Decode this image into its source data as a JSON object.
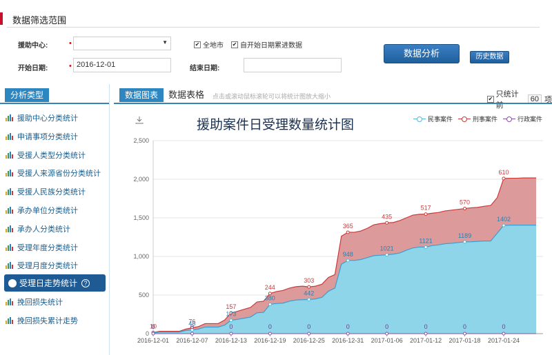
{
  "header": {
    "title": "数据筛选范围"
  },
  "filters": {
    "center_label": "援助中心:",
    "center_value": "",
    "all_city_label": "全地市",
    "cumulative_label": "自开始日期累进数据",
    "start_label": "开始日期:",
    "start_value": "2016-12-01",
    "end_label": "结束日期:",
    "end_value": "",
    "analyze_button": "数据分析",
    "history_button": "历史数据"
  },
  "sidebar": {
    "title": "分析类型",
    "items": [
      {
        "label": "援助中心分类统计"
      },
      {
        "label": "申请事项分类统计"
      },
      {
        "label": "受援人类型分类统计"
      },
      {
        "label": "受援人来源省份分类统计"
      },
      {
        "label": "受援人民族分类统计"
      },
      {
        "label": "承办单位分类统计"
      },
      {
        "label": "承办人分类统计"
      },
      {
        "label": "受理年度分类统计"
      },
      {
        "label": "受理月度分类统计"
      }
    ],
    "active_item": {
      "label": "受理日走势统计"
    },
    "after_items": [
      {
        "label": "挽回损失统计"
      },
      {
        "label": "挽回损失累计走势"
      }
    ]
  },
  "main": {
    "tab_chart": "数据图表",
    "tab_table": "数据表格",
    "hint": "点击或滚动鼠标滚轮可以将统计图放大缩小",
    "only_prefix": "只统计前",
    "only_count": "60",
    "only_suffix": "项"
  },
  "chart_data": {
    "type": "area",
    "title": "援助案件日受理数量统计图",
    "x": [
      "2016-12-01",
      "2016-12-02",
      "2016-12-03",
      "2016-12-04",
      "2016-12-05",
      "2016-12-06",
      "2016-12-07",
      "2016-12-08",
      "2016-12-09",
      "2016-12-10",
      "2016-12-11",
      "2016-12-12",
      "2016-12-13",
      "2016-12-14",
      "2016-12-15",
      "2016-12-16",
      "2016-12-17",
      "2016-12-18",
      "2016-12-19",
      "2016-12-20",
      "2016-12-21",
      "2016-12-22",
      "2016-12-23",
      "2016-12-24",
      "2016-12-25",
      "2016-12-26",
      "2016-12-27",
      "2016-12-28",
      "2016-12-29",
      "2016-12-30",
      "2016-12-31",
      "2017-01-01",
      "2017-01-02",
      "2017-01-03",
      "2017-01-04",
      "2017-01-05",
      "2017-01-06",
      "2017-01-07",
      "2017-01-08",
      "2017-01-09",
      "2017-01-10",
      "2017-01-11",
      "2017-01-12",
      "2017-01-13",
      "2017-01-14",
      "2017-01-15",
      "2017-01-16",
      "2017-01-17",
      "2017-01-18",
      "2017-01-19",
      "2017-01-20",
      "2017-01-21",
      "2017-01-22",
      "2017-01-23",
      "2017-01-24",
      "2017-01-25",
      "2017-01-26",
      "2017-01-27",
      "2017-01-28",
      "2017-01-29"
    ],
    "x_ticks": [
      "2016-12-01",
      "2016-12-07",
      "2016-12-13",
      "2016-12-19",
      "2016-12-25",
      "2016-12-31",
      "2017-01-06",
      "2017-01-12",
      "2017-01-18",
      "2017-01-24"
    ],
    "ylim": [
      0,
      2500
    ],
    "y_ticks": [
      0,
      500,
      1000,
      1500,
      2000,
      2500
    ],
    "y_tick_labels": [
      "0",
      "500",
      "1,000",
      "1,500",
      "2,000",
      "2,500"
    ],
    "series": [
      {
        "name": "民事案件",
        "color": "#55b8d8",
        "values": [
          10,
          20,
          20,
          20,
          20,
          40,
          48,
          60,
          85,
          85,
          85,
          110,
          173,
          185,
          200,
          215,
          270,
          275,
          380,
          390,
          395,
          420,
          435,
          440,
          442,
          450,
          470,
          550,
          590,
          900,
          948,
          948,
          960,
          985,
          1010,
          1015,
          1021,
          1030,
          1045,
          1080,
          1110,
          1121,
          1121,
          1140,
          1150,
          1165,
          1170,
          1180,
          1189,
          1190,
          1195,
          1200,
          1200,
          1300,
          1402,
          1405,
          1405,
          1405,
          1405,
          1405
        ]
      },
      {
        "name": "刑事案件",
        "color": "#c83a3a",
        "values": [
          5,
          10,
          10,
          10,
          10,
          18,
          28,
          32,
          45,
          45,
          45,
          65,
          95,
          105,
          115,
          125,
          140,
          145,
          140,
          155,
          165,
          170,
          173,
          175,
          163,
          165,
          170,
          178,
          175,
          362,
          365,
          365,
          370,
          380,
          400,
          410,
          414,
          410,
          420,
          420,
          425,
          425,
          427,
          420,
          420,
          425,
          430,
          430,
          431,
          440,
          440,
          450,
          460,
          460,
          608,
          608,
          608,
          612,
          612,
          612
        ]
      },
      {
        "name": "行政案件",
        "color": "#8a4fa8",
        "values": [
          0,
          0,
          0,
          0,
          0,
          0,
          0,
          0,
          0,
          0,
          0,
          0,
          0,
          0,
          0,
          0,
          0,
          0,
          0,
          0,
          0,
          0,
          0,
          0,
          0,
          0,
          0,
          0,
          0,
          0,
          0,
          0,
          0,
          0,
          0,
          0,
          0,
          0,
          0,
          0,
          0,
          0,
          0,
          0,
          0,
          0,
          0,
          0,
          0,
          0,
          0,
          0,
          0,
          0,
          0,
          0,
          0,
          0,
          0,
          0
        ]
      }
    ],
    "data_labels": [
      {
        "series": "刑事案件",
        "index": 0,
        "text": "10"
      },
      {
        "series": "刑事案件",
        "index": 6,
        "text": "76"
      },
      {
        "series": "刑事案件",
        "index": 12,
        "text": "157"
      },
      {
        "series": "刑事案件",
        "index": 18,
        "text": "244"
      },
      {
        "series": "刑事案件",
        "index": 24,
        "text": "303"
      },
      {
        "series": "刑事案件",
        "index": 30,
        "text": "365"
      },
      {
        "series": "刑事案件",
        "index": 36,
        "text": "435"
      },
      {
        "series": "刑事案件",
        "index": 42,
        "text": "517"
      },
      {
        "series": "刑事案件",
        "index": 48,
        "text": "570"
      },
      {
        "series": "刑事案件",
        "index": 54,
        "text": "610"
      },
      {
        "series": "民事案件",
        "index": 0,
        "text": "0"
      },
      {
        "series": "民事案件",
        "index": 6,
        "text": "48"
      },
      {
        "series": "民事案件",
        "index": 12,
        "text": "173"
      },
      {
        "series": "民事案件",
        "index": 18,
        "text": "380"
      },
      {
        "series": "民事案件",
        "index": 24,
        "text": "442"
      },
      {
        "series": "民事案件",
        "index": 30,
        "text": "948"
      },
      {
        "series": "民事案件",
        "index": 36,
        "text": "1021"
      },
      {
        "series": "民事案件",
        "index": 42,
        "text": "1121"
      },
      {
        "series": "民事案件",
        "index": 48,
        "text": "1189"
      },
      {
        "series": "民事案件",
        "index": 54,
        "text": "1402"
      },
      {
        "series": "行政案件",
        "index": 0,
        "text": "0"
      },
      {
        "series": "行政案件",
        "index": 6,
        "text": "0"
      },
      {
        "series": "行政案件",
        "index": 12,
        "text": "0"
      },
      {
        "series": "行政案件",
        "index": 18,
        "text": "0"
      },
      {
        "series": "行政案件",
        "index": 24,
        "text": "0"
      },
      {
        "series": "行政案件",
        "index": 30,
        "text": "0"
      },
      {
        "series": "行政案件",
        "index": 36,
        "text": "0"
      },
      {
        "series": "行政案件",
        "index": 42,
        "text": "0"
      },
      {
        "series": "行政案件",
        "index": 48,
        "text": "0"
      },
      {
        "series": "行政案件",
        "index": 54,
        "text": "0"
      }
    ],
    "stacked": true,
    "grid": true,
    "legend_position": "top-right"
  }
}
